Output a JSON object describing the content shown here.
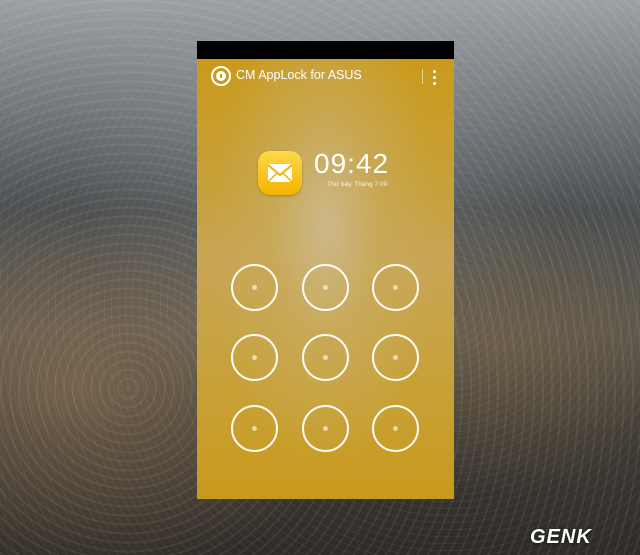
{
  "app": {
    "title": "CM AppLock for ASUS",
    "logo_icon": "lock-icon",
    "menu_icon": "more-vertical-icon"
  },
  "lockscreen": {
    "notification_icon": "mail-icon",
    "time": "09:42",
    "date": "Thứ bảy, Tháng 7 09",
    "pattern_dots": [
      1,
      2,
      3,
      4,
      5,
      6,
      7,
      8,
      9
    ]
  },
  "watermark": "GENK",
  "colors": {
    "accent": "#c99a1b",
    "icon": "#f6c51f"
  }
}
